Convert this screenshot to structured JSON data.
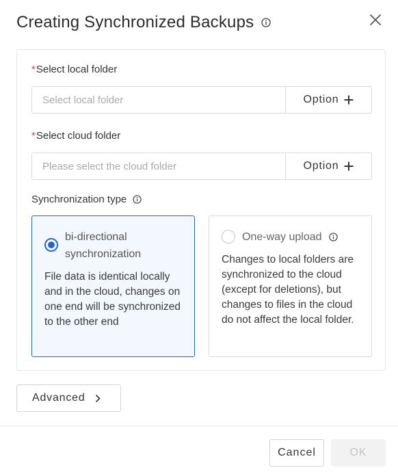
{
  "dialog": {
    "title": "Creating Synchronized Backups",
    "title_icon": "info-circle-icon",
    "close_icon": "close-icon"
  },
  "local_folder": {
    "required_mark": "*",
    "label": "Select local folder",
    "placeholder": "Select local folder",
    "value": "",
    "option_label": "Option",
    "option_icon": "plus-icon"
  },
  "cloud_folder": {
    "required_mark": "*",
    "label": "Select cloud folder",
    "placeholder": "Please select the cloud folder",
    "value": "",
    "option_label": "Option",
    "option_icon": "plus-icon"
  },
  "sync_type": {
    "label": "Synchronization type",
    "label_icon": "info-circle-icon",
    "selected": "bi-directional",
    "options": [
      {
        "title": "bi-directional synchronization",
        "description": "File data is identical locally and in the cloud, changes on one end will be synchronized to the other end"
      },
      {
        "title": "One-way upload",
        "title_icon": "info-circle-icon",
        "description": "Changes to local folders are synchronized to the cloud (except for deletions), but changes to files in the cloud do not affect the local folder."
      }
    ]
  },
  "advanced": {
    "label": "Advanced",
    "icon": "chevron-right-icon"
  },
  "footer": {
    "cancel_label": "Cancel",
    "ok_label": "OK"
  },
  "colors": {
    "accent": "#1f67c8",
    "selected_card_bg": "#f3f7fe",
    "required": "#e0453a",
    "disabled_text": "#c4c4c4",
    "disabled_bg": "#f2f2f2"
  }
}
